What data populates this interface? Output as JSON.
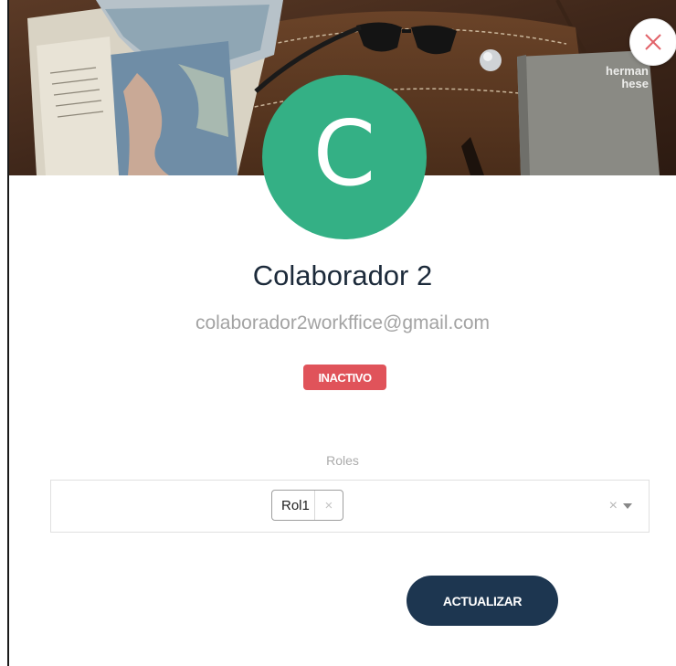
{
  "profile": {
    "avatar_initial": "C",
    "avatar_color": "#34b085",
    "name": "Colaborador 2",
    "email": "colaborador2workffice@gmail.com",
    "status_badge": "INACTIVO",
    "status_color": "#e0535a"
  },
  "cover": {
    "book_title": "herman hese"
  },
  "roles": {
    "label": "Roles",
    "selected": [
      "Rol1"
    ],
    "chip_remove": "×",
    "clear": "×"
  },
  "actions": {
    "update_label": "ACTUALIZAR",
    "close_icon": "close-icon"
  },
  "theme": {
    "primary": "#1d3650",
    "danger": "#e0535a"
  }
}
